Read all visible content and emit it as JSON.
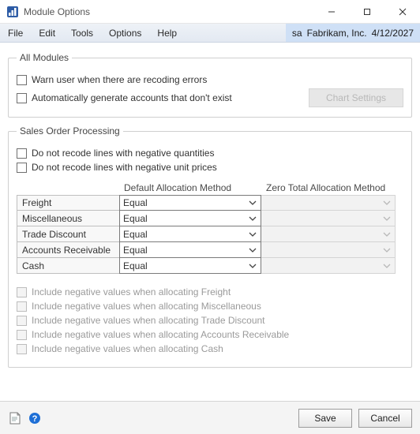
{
  "window": {
    "title": "Module Options"
  },
  "menu": {
    "file": "File",
    "edit": "Edit",
    "tools": "Tools",
    "options": "Options",
    "help": "Help"
  },
  "status": {
    "user": "sa",
    "company": "Fabrikam, Inc.",
    "date": "4/12/2027"
  },
  "groups": {
    "all_modules": {
      "legend": "All Modules",
      "warn_label": "Warn user when there are recoding errors",
      "autogen_label": "Automatically generate accounts that don't exist",
      "chart_button": "Chart Settings"
    },
    "sop": {
      "legend": "Sales Order Processing",
      "neg_qty_label": "Do not recode lines with negative quantities",
      "neg_price_label": "Do not recode lines with negative unit prices",
      "headers": {
        "default_alloc": "Default Allocation Method",
        "zero_alloc": "Zero Total Allocation Method"
      },
      "rows": [
        {
          "label": "Freight",
          "default": "Equal",
          "zero": ""
        },
        {
          "label": "Miscellaneous",
          "default": "Equal",
          "zero": ""
        },
        {
          "label": "Trade Discount",
          "default": "Equal",
          "zero": ""
        },
        {
          "label": "Accounts Receivable",
          "default": "Equal",
          "zero": ""
        },
        {
          "label": "Cash",
          "default": "Equal",
          "zero": ""
        }
      ],
      "include": [
        "Include negative values when allocating Freight",
        "Include negative values when allocating Miscellaneous",
        "Include negative values when allocating Trade Discount",
        "Include negative values when allocating Accounts Receivable",
        "Include negative values when allocating Cash"
      ]
    }
  },
  "footer": {
    "save": "Save",
    "cancel": "Cancel"
  }
}
